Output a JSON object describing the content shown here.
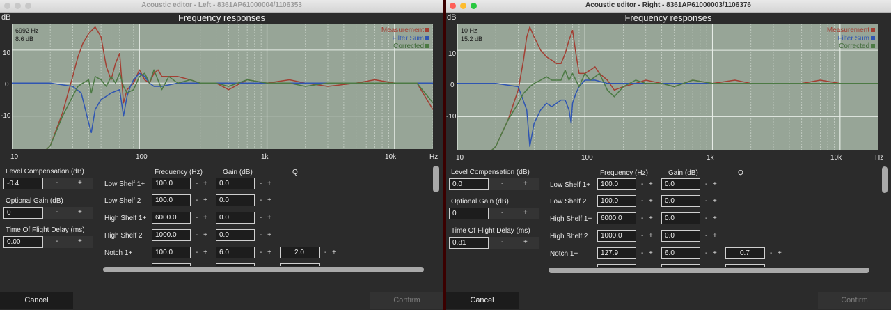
{
  "colors": {
    "measurement": "#a33f33",
    "filter_sum": "#2f55b2",
    "corrected": "#4c7a44",
    "plot_bg": "#97a597"
  },
  "windows": [
    {
      "title": "Acoustic editor - Left - 8361AP61000004/1106353",
      "chart": {
        "title": "Frequency responses",
        "y_unit": "dB",
        "x_unit": "Hz",
        "cursor_freq": "6992 Hz",
        "cursor_db": "8.6 dB",
        "y_ticks": [
          "10",
          "0",
          "-10"
        ],
        "x_ticks": [
          "10",
          "100",
          "1k",
          "10k"
        ]
      },
      "left_params": [
        {
          "label": "Level Compensation (dB)",
          "value": "-0.4"
        },
        {
          "label": "Optional Gain (dB)",
          "value": "0"
        },
        {
          "label": "Time Of Flight Delay (ms)",
          "value": "0.00"
        }
      ],
      "col_headers": {
        "freq": "Frequency (Hz)",
        "gain": "Gain (dB)",
        "q": "Q"
      },
      "filters": [
        {
          "name": "Low Shelf 1+",
          "freq": "100.0",
          "gain": "0.0",
          "q": ""
        },
        {
          "name": "Low Shelf 2",
          "freq": "100.0",
          "gain": "0.0",
          "q": ""
        },
        {
          "name": "High Shelf 1+",
          "freq": "6000.0",
          "gain": "0.0",
          "q": ""
        },
        {
          "name": "High Shelf 2",
          "freq": "1000.0",
          "gain": "0.0",
          "q": ""
        },
        {
          "name": "Notch 1+",
          "freq": "100.0",
          "gain": "6.0",
          "q": "2.0"
        }
      ],
      "buttons": {
        "cancel": "Cancel",
        "confirm": "Confirm"
      }
    },
    {
      "title": "Acoustic editor - Right - 8361AP61000003/1106376",
      "chart": {
        "title": "Frequency responses",
        "y_unit": "dB",
        "x_unit": "Hz",
        "cursor_freq": "10 Hz",
        "cursor_db": "15.2 dB",
        "y_ticks": [
          "10",
          "0",
          "-10"
        ],
        "x_ticks": [
          "10",
          "100",
          "1k",
          "10k"
        ]
      },
      "left_params": [
        {
          "label": "Level Compensation (dB)",
          "value": "0.0"
        },
        {
          "label": "Optional Gain (dB)",
          "value": "0"
        },
        {
          "label": "Time Of Flight Delay (ms)",
          "value": "0.81"
        }
      ],
      "col_headers": {
        "freq": "Frequency (Hz)",
        "gain": "Gain (dB)",
        "q": "Q"
      },
      "filters": [
        {
          "name": "Low Shelf 1+",
          "freq": "100.0",
          "gain": "0.0",
          "q": ""
        },
        {
          "name": "Low Shelf 2",
          "freq": "100.0",
          "gain": "0.0",
          "q": ""
        },
        {
          "name": "High Shelf 1+",
          "freq": "6000.0",
          "gain": "0.0",
          "q": ""
        },
        {
          "name": "High Shelf 2",
          "freq": "1000.0",
          "gain": "0.0",
          "q": ""
        },
        {
          "name": "Notch 1+",
          "freq": "127.9",
          "gain": "6.0",
          "q": "0.7"
        }
      ],
      "buttons": {
        "cancel": "Cancel",
        "confirm": "Confirm"
      }
    }
  ],
  "legend": [
    "Measurement",
    "Filter Sum",
    "Corrected"
  ],
  "sign": {
    "minus": "-",
    "plus": "+"
  },
  "chart_data": [
    {
      "type": "line",
      "x_scale": "log",
      "xlim": [
        10,
        20000
      ],
      "ylim": [
        -20,
        18
      ],
      "series": [
        {
          "name": "Measurement",
          "x": [
            10,
            20,
            25,
            30,
            33,
            36,
            40,
            45,
            50,
            55,
            60,
            65,
            70,
            75,
            80,
            90,
            100,
            110,
            120,
            130,
            140,
            150,
            170,
            200,
            250,
            300,
            400,
            500,
            700,
            1000,
            1500,
            2000,
            3000,
            5000,
            7000,
            10000,
            15000,
            20000
          ],
          "y": [
            -30,
            -19,
            -9,
            2,
            8,
            12,
            15,
            17,
            14,
            5,
            1,
            6,
            9,
            -6,
            -2,
            0,
            4,
            1,
            0,
            3,
            4,
            2,
            2,
            2,
            1,
            0,
            0,
            -2,
            1,
            0,
            1,
            0,
            -1,
            0,
            1,
            0,
            0,
            -8
          ]
        },
        {
          "name": "Filter Sum",
          "x": [
            10,
            20,
            30,
            35,
            40,
            42,
            45,
            50,
            55,
            60,
            70,
            75,
            80,
            85,
            90,
            100,
            110,
            120,
            130,
            150,
            200,
            300,
            500,
            1000,
            20000
          ],
          "y": [
            0,
            0,
            -1,
            -3,
            -12,
            -15,
            -8,
            -5,
            -4,
            -3,
            -2,
            -10,
            -4,
            -1,
            1,
            3,
            2,
            0,
            -1,
            -1,
            0,
            0,
            0,
            0,
            0
          ]
        },
        {
          "name": "Corrected",
          "x": [
            10,
            20,
            25,
            30,
            33,
            36,
            40,
            42,
            45,
            50,
            55,
            60,
            65,
            70,
            75,
            80,
            90,
            100,
            110,
            120,
            130,
            150,
            170,
            200,
            250,
            300,
            400,
            500,
            700,
            1000,
            1500,
            2000,
            3000,
            5000,
            7000,
            10000,
            15000,
            20000
          ],
          "y": [
            -30,
            -19,
            -10,
            -4,
            -1,
            0,
            1,
            -3,
            2,
            1,
            -1,
            2,
            0,
            3,
            -1,
            -3,
            -2,
            2,
            3,
            0,
            4,
            -2,
            2,
            0,
            1,
            0,
            0,
            -1,
            1,
            0,
            0,
            -1,
            0,
            0,
            0,
            0,
            0,
            -6
          ]
        }
      ]
    },
    {
      "type": "line",
      "x_scale": "log",
      "xlim": [
        10,
        20000
      ],
      "ylim": [
        -20,
        18
      ],
      "series": [
        {
          "name": "Measurement",
          "x": [
            10,
            20,
            25,
            30,
            33,
            35,
            37,
            40,
            45,
            50,
            55,
            60,
            65,
            70,
            75,
            80,
            85,
            90,
            100,
            110,
            120,
            130,
            150,
            170,
            200,
            250,
            300,
            400,
            500,
            700,
            1000,
            1500,
            2000,
            3000,
            5000,
            7000,
            10000,
            15000,
            20000
          ],
          "y": [
            -30,
            -19,
            -11,
            -2,
            7,
            14,
            17,
            14,
            10,
            8,
            7,
            6,
            6,
            9,
            13,
            16,
            9,
            3,
            3,
            4,
            5,
            3,
            1,
            -2,
            -1,
            0,
            1,
            0,
            -1,
            1,
            0,
            1,
            0,
            0,
            0,
            1,
            0,
            0,
            0
          ]
        },
        {
          "name": "Filter Sum",
          "x": [
            10,
            20,
            30,
            35,
            37,
            40,
            45,
            50,
            55,
            60,
            65,
            70,
            75,
            78,
            80,
            85,
            90,
            100,
            120,
            150,
            200,
            300,
            500,
            1000,
            20000
          ],
          "y": [
            0,
            0,
            -1,
            -8,
            -19,
            -12,
            -8,
            -6,
            -7,
            -6,
            -5,
            -5,
            -8,
            -12,
            -6,
            -3,
            -1,
            1,
            1,
            0,
            0,
            0,
            0,
            0,
            0
          ]
        },
        {
          "name": "Corrected",
          "x": [
            10,
            20,
            25,
            30,
            33,
            35,
            37,
            40,
            45,
            50,
            55,
            60,
            65,
            70,
            75,
            80,
            85,
            90,
            100,
            110,
            120,
            130,
            150,
            170,
            200,
            250,
            300,
            400,
            500,
            700,
            1000,
            1500,
            2000,
            3000,
            5000,
            7000,
            10000,
            15000,
            20000
          ],
          "y": [
            -30,
            -19,
            -11,
            -6,
            -3,
            -2,
            -1,
            0,
            1,
            2,
            1,
            1,
            1,
            4,
            1,
            3,
            1,
            -1,
            3,
            1,
            2,
            3,
            -2,
            -4,
            -1,
            1,
            0,
            0,
            -1,
            1,
            0,
            0,
            0,
            0,
            0,
            0,
            0,
            0,
            0
          ]
        }
      ]
    }
  ]
}
